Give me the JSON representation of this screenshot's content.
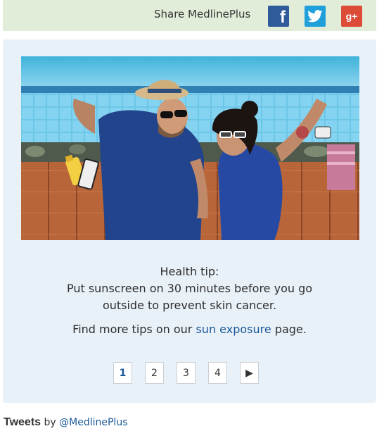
{
  "share": {
    "label": "Share MedlinePlus",
    "facebook_glyph": "f",
    "twitter_icon": "twitter-bird-icon",
    "googleplus_glyph": "g+",
    "colors": {
      "bar_bg": "#e2edd9",
      "facebook": "#2f5b9b",
      "twitter": "#1fa0db",
      "googleplus": "#dd4b39"
    }
  },
  "carousel": {
    "image_icon": "sunbathing-couple-photo",
    "tip_heading": "Health tip:",
    "tip_line1": "Put sunscreen on 30 minutes before you go",
    "tip_line2": "outside to prevent skin cancer.",
    "more_prefix": "Find more tips on our ",
    "more_link": "sun exposure",
    "more_suffix": " page.",
    "pages": [
      "1",
      "2",
      "3",
      "4"
    ],
    "active_page": "1",
    "next_glyph": "▶",
    "colors": {
      "panel_bg": "#e8f1f8",
      "link": "#1b5899"
    }
  },
  "tweets": {
    "label": "Tweets",
    "by": "by",
    "handle": "@MedlinePlus"
  }
}
